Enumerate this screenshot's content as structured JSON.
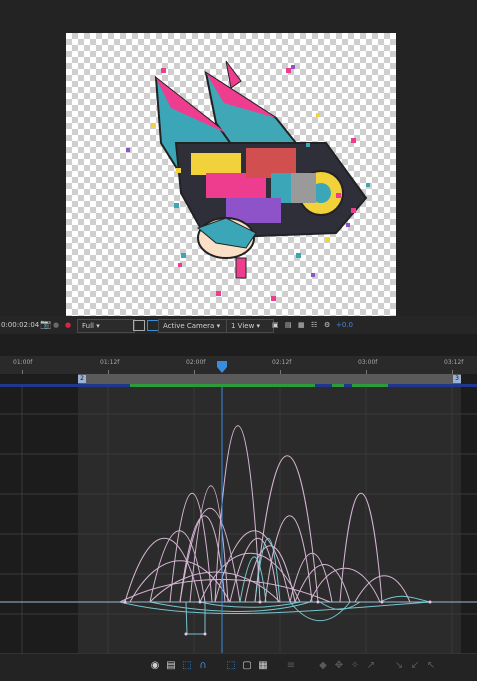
{
  "viewer": {
    "timecode": "0:00:02:04",
    "resolution": "Full",
    "camera": "Active Camera",
    "view_layout": "1 View",
    "exposure": "+0.0"
  },
  "timeline": {
    "ruler_labels": [
      "01:00f",
      "01:12f",
      "02:00f",
      "02:12f",
      "03:00f",
      "03:12f"
    ],
    "work_area_start_marker": "2",
    "work_area_end_marker": "3"
  },
  "colors": {
    "accent_blue": "#3a8ddb",
    "curve_pink": "#e8c4e6",
    "curve_cyan": "#7fd6e0",
    "workarea_green": "#2c9b3c"
  },
  "graph_editor_tools": [
    "eye-icon",
    "graph-type-icon",
    "transform-box-icon",
    "snap-icon",
    "fit-selection-icon",
    "fit-all-icon",
    "edit-keyframe-icon",
    "hold-icon",
    "linear-icon",
    "auto-bezier-icon",
    "easy-ease-icon",
    "easy-ease-in-icon",
    "easy-ease-out-icon"
  ]
}
